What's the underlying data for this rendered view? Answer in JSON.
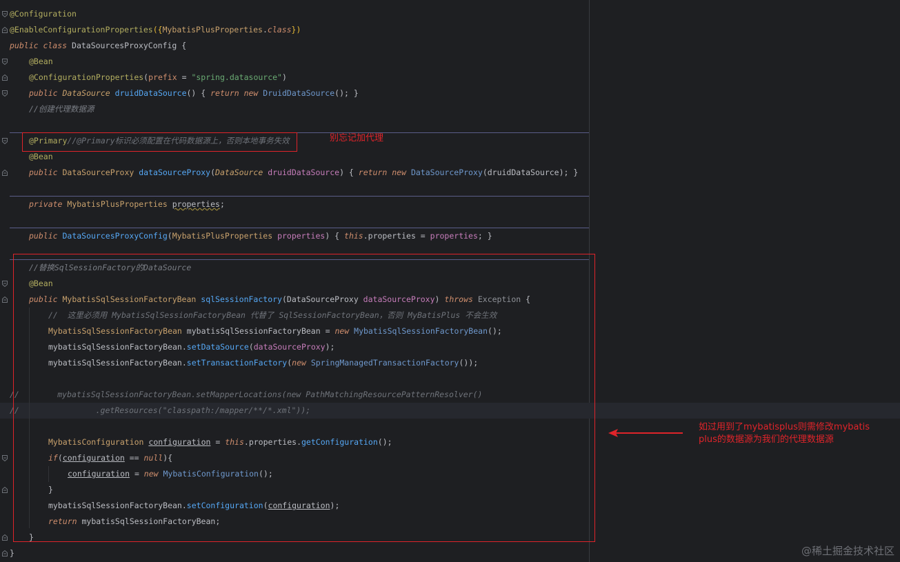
{
  "lines": {
    "l1": "@Configuration",
    "l2a": "@EnableConfigurationProperties",
    "l2b": "({",
    "l2c": "MybatisPlusProperties",
    "l2d": ".",
    "l2e": "class",
    "l2f": "})",
    "l3a": "public class ",
    "l3b": "DataSourcesProxyConfig",
    "l3c": " {",
    "l4": "@Bean",
    "l5a": "@ConfigurationProperties",
    "l5b": "(",
    "l5c": "prefix",
    "l5d": " = ",
    "l5e": "\"spring.datasource\"",
    "l5f": ")",
    "l6a": "public ",
    "l6b": "DataSource ",
    "l6c": "druidDataSource",
    "l6d": "() { ",
    "l6e": "return new ",
    "l6f": "DruidDataSource",
    "l6g": "(); }",
    "l7": "//创建代理数据源",
    "l9a": "@Primary",
    "l9b": "//@Primary标识必须配置在代码数据源上，否则本地事务失效",
    "l10": "@Bean",
    "l11a": "public ",
    "l11b": "DataSourceProxy ",
    "l11c": "dataSourceProxy",
    "l11d": "(",
    "l11e": "DataSource ",
    "l11f": "druidDataSource",
    "l11g": ") { ",
    "l11h": "return new ",
    "l11i": "DataSourceProxy",
    "l11j": "(druidDataSource); }",
    "l13a": "private ",
    "l13b": "MybatisPlusProperties ",
    "l13c": "properties",
    "l13d": ";",
    "l15a": "public ",
    "l15b": "DataSourcesProxyConfig",
    "l15c": "(",
    "l15d": "MybatisPlusProperties ",
    "l15e": "properties",
    "l15f": ") { ",
    "l15g": "this",
    "l15h": ".properties = ",
    "l15i": "properties",
    "l15j": "; }",
    "l17": "//替换SqlSessionFactory的DataSource",
    "l18": "@Bean",
    "l19a": "public ",
    "l19b": "MybatisSqlSessionFactoryBean ",
    "l19c": "sqlSessionFactory",
    "l19d": "(DataSourceProxy ",
    "l19e": "dataSourceProxy",
    "l19f": ") ",
    "l19g": "throws ",
    "l19h": "Exception",
    "l19i": " {",
    "l20": "//  这里必须用 MybatisSqlSessionFactoryBean 代替了 SqlSessionFactoryBean，否则 MyBatisPlus 不会生效",
    "l21a": "MybatisSqlSessionFactoryBean ",
    "l21b": "mybatisSqlSessionFactoryBean = ",
    "l21c": "new ",
    "l21d": "MybatisSqlSessionFactoryBean",
    "l21e": "();",
    "l22a": "mybatisSqlSessionFactoryBean.",
    "l22b": "setDataSource",
    "l22c": "(",
    "l22d": "dataSourceProxy",
    "l22e": ");",
    "l23a": "mybatisSqlSessionFactoryBean.",
    "l23b": "setTransactionFactory",
    "l23c": "(",
    "l23d": "new ",
    "l23e": "SpringManagedTransactionFactory",
    "l23f": "());",
    "l25a": "//",
    "l25b": "        mybatisSqlSessionFactoryBean.setMapperLocations(new PathMatchingResourcePatternResolver()",
    "l26a": "//",
    "l26b": "                .getResources(\"classpath:/mapper/**/*.xml\"));",
    "l28a": "MybatisConfiguration ",
    "l28b": "configuration",
    "l28c": " = ",
    "l28d": "this",
    "l28e": ".properties.",
    "l28f": "getConfiguration",
    "l28g": "();",
    "l29a": "if",
    "l29b": "(",
    "l29c": "configuration",
    "l29d": " == ",
    "l29e": "null",
    "l29f": "){",
    "l30a": "configuration",
    "l30b": " = ",
    "l30c": "new ",
    "l30d": "MybatisConfiguration",
    "l30e": "();",
    "l31": "}",
    "l32a": "mybatisSqlSessionFactoryBean.",
    "l32b": "setConfiguration",
    "l32c": "(",
    "l32d": "configuration",
    "l32e": ");",
    "l33a": "return ",
    "l33b": "mybatisSqlSessionFactoryBean;",
    "l34": "}",
    "l35": "}"
  },
  "annotations": {
    "note_proxy": "别忘记加代理",
    "note_mybatis_line1": "如过用到了mybatisplus则需修改mybatis",
    "note_mybatis_line2": "plus的数据源为我们的代理数据源"
  },
  "watermark": "@稀土掘金技术社区",
  "colors": {
    "background": "#1e1f22",
    "annotation_red": "#e0242a",
    "keyword": "#cf8e6d",
    "function": "#56a8f5",
    "string": "#6aab73"
  }
}
